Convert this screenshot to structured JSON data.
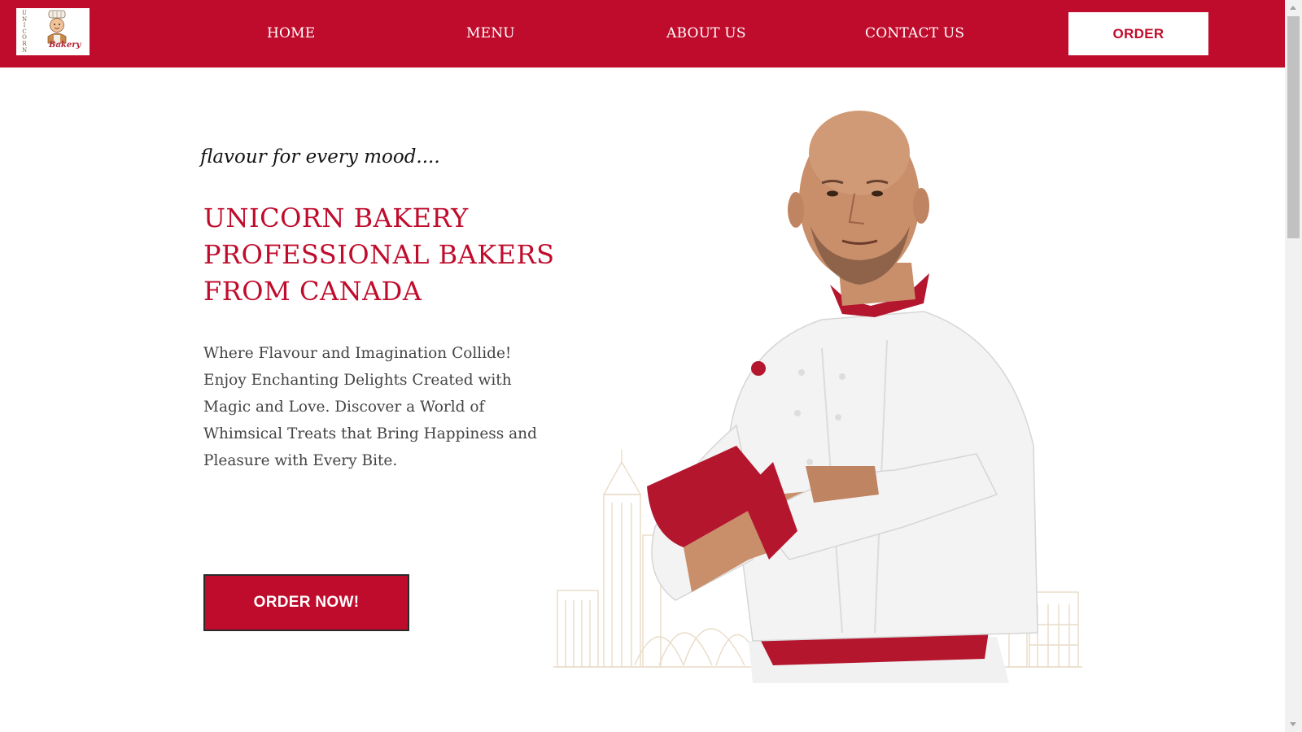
{
  "header": {
    "logo": {
      "vertical_text": [
        "U",
        "N",
        "I",
        "C",
        "O",
        "R",
        "N"
      ],
      "script_text": "Bakery"
    },
    "nav": [
      {
        "label": "HOME"
      },
      {
        "label": "MENU"
      },
      {
        "label": "ABOUT US"
      },
      {
        "label": "CONTACT US"
      }
    ],
    "order_button_label": "ORDER"
  },
  "hero": {
    "tagline": "flavour for every mood....",
    "headline_lines": [
      "UNICORN BAKERY",
      "PROFESSIONAL BAKERS",
      "FROM CANADA"
    ],
    "description": "Where Flavour and Imagination Collide! Enjoy Enchanting Delights Created with Magic and Love. Discover a World of Whimsical Treats that Bring Happiness and Pleasure with Every Bite.",
    "cta_label": "ORDER NOW!"
  },
  "colors": {
    "brand_red": "#c00c2c",
    "text_dark": "#141414",
    "text_body": "#444444",
    "skyline": "#e9dcc8",
    "jacket_white": "#f3f3f3",
    "skin": "#c98e6a"
  }
}
